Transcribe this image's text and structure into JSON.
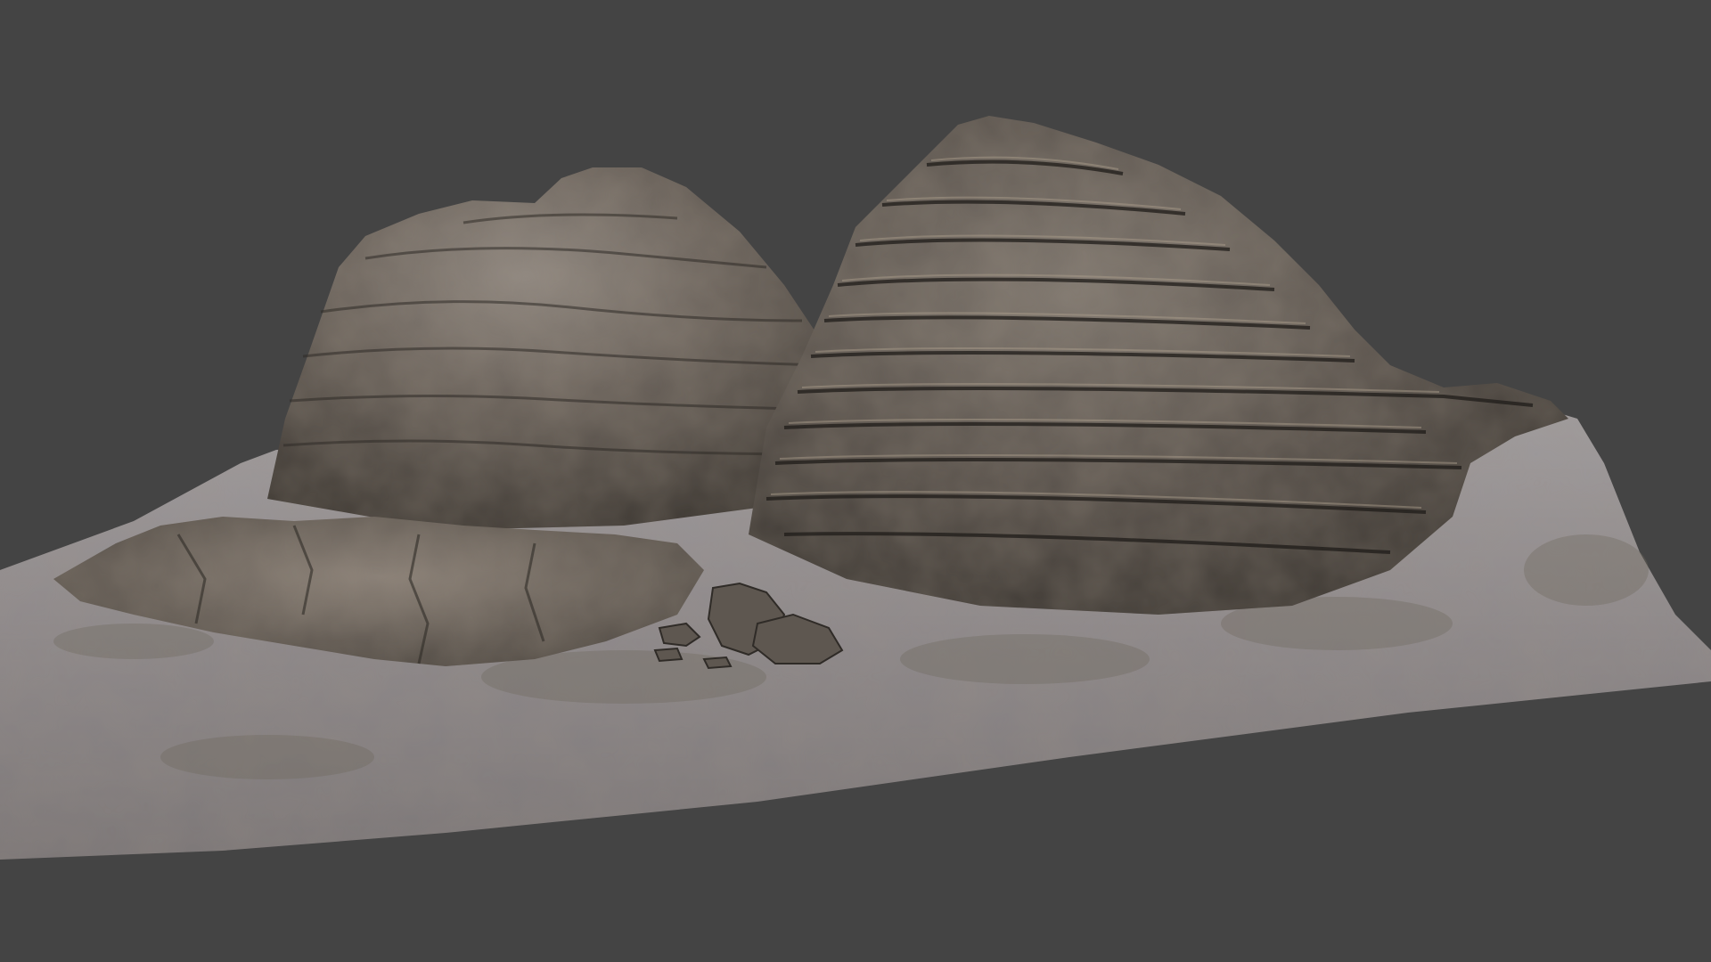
{
  "viewport": {
    "background_color": "#444444",
    "ground_color": "#8f8b8c",
    "ground_shadow_color": "#6e665c",
    "rock_light_color": "#8a817a",
    "rock_mid_color": "#5c554f",
    "rock_dark_color": "#2f2b27",
    "rock_highlight_color": "#b0a28f"
  }
}
